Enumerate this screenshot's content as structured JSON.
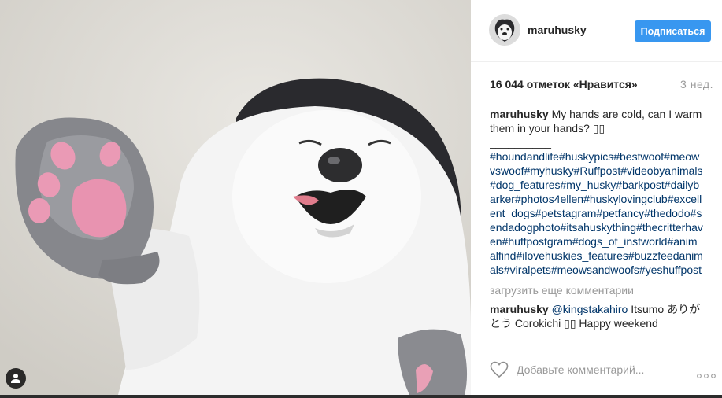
{
  "post": {
    "username": "maruhusky",
    "follow_label": "Подписаться",
    "likes": "16 044 отметок «Нравится»",
    "time": "3 нед.",
    "caption": {
      "user": "maruhusky",
      "text": "My hands are cold, can I warm them in your hands? ▯▯",
      "separator": "__________",
      "hashtags": "#houndandlife#huskypics#bestwoof#meowvswoof#myhusky#Ruffpost#videobyanimals#dog_features#my_husky#barkpost#dailybarker#photos4ellen#huskylovingclub#excellent_dogs#petstagram#petfancy#thedodo#sendadogphoto#itsahuskything#thecritterhaven#huffpostgram#dogs_of_instworld#animalfind#ilovehuskies_features#buzzfeedanimals#viralpets#meowsandwoofs#yeshuffpost"
    },
    "load_more": "загрузить еще комментарии",
    "reply": {
      "user": "maruhusky",
      "mention": "@kingstakahiro",
      "text": "Itsumo ありがとう Corokichi ▯▯ Happy weekend"
    },
    "comment_placeholder": "Добавьте комментарий...",
    "more_label": "•••"
  },
  "colors": {
    "accent": "#3897f0",
    "hashtag": "#003569",
    "muted": "#999999"
  },
  "icons": {
    "user_tag": "person-icon",
    "like": "heart-icon",
    "options": "more-options-icon"
  }
}
